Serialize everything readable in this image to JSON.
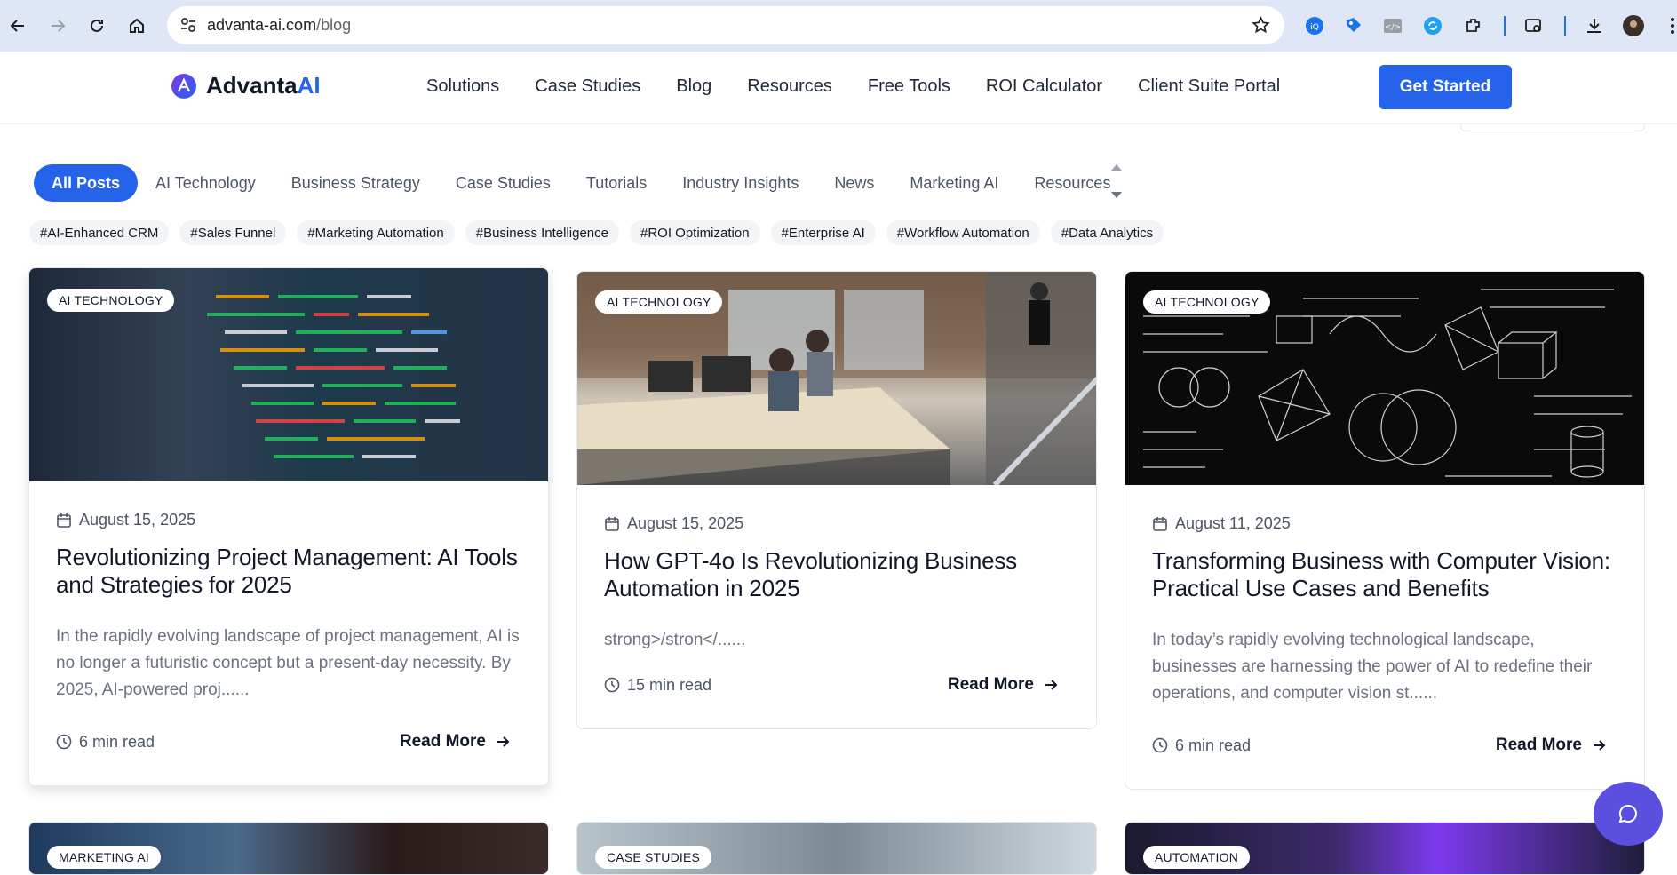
{
  "browser": {
    "url_domain": "advanta-ai.com",
    "url_path": "/blog"
  },
  "header": {
    "logo_text": "Advanta",
    "logo_accent": "AI",
    "menu": [
      "Solutions",
      "Case Studies",
      "Blog",
      "Resources",
      "Free Tools",
      "ROI Calculator",
      "Client Suite Portal"
    ],
    "cta_label": "Get Started"
  },
  "categories": [
    "All Posts",
    "AI Technology",
    "Business Strategy",
    "Case Studies",
    "Tutorials",
    "Industry Insights",
    "News",
    "Marketing AI",
    "Resources"
  ],
  "tags": [
    "#AI-Enhanced CRM",
    "#Sales Funnel",
    "#Marketing Automation",
    "#Business Intelligence",
    "#ROI Optimization",
    "#Enterprise AI",
    "#Workflow Automation",
    "#Data Analytics"
  ],
  "posts": [
    {
      "badge": "AI TECHNOLOGY",
      "date": "August 15, 2025",
      "title": "Revolutionizing Project Management: AI Tools and Strategies for 2025",
      "excerpt": "In the rapidly evolving landscape of project management, AI is no longer a futuristic concept but a present-day necessity. By 2025, AI-powered proj......",
      "read_time": "6 min read",
      "read_more": "Read More"
    },
    {
      "badge": "AI TECHNOLOGY",
      "date": "August 15, 2025",
      "title": "How GPT-4o Is Revolutionizing Business Automation in 2025",
      "excerpt": "strong>/stron</......",
      "read_time": "15 min read",
      "read_more": "Read More"
    },
    {
      "badge": "AI TECHNOLOGY",
      "date": "August 11, 2025",
      "title": "Transforming Business with Computer Vision: Practical Use Cases and Benefits",
      "excerpt": "In today’s rapidly evolving technological landscape, businesses are harnessing the power of AI to redefine their operations, and computer vision st......",
      "read_time": "6 min read",
      "read_more": "Read More"
    }
  ],
  "next_row_badges": [
    "MARKETING AI",
    "CASE STUDIES",
    "AUTOMATION"
  ],
  "colors": {
    "accent": "#2563eb",
    "chat_fab": "#5b4fe0"
  }
}
